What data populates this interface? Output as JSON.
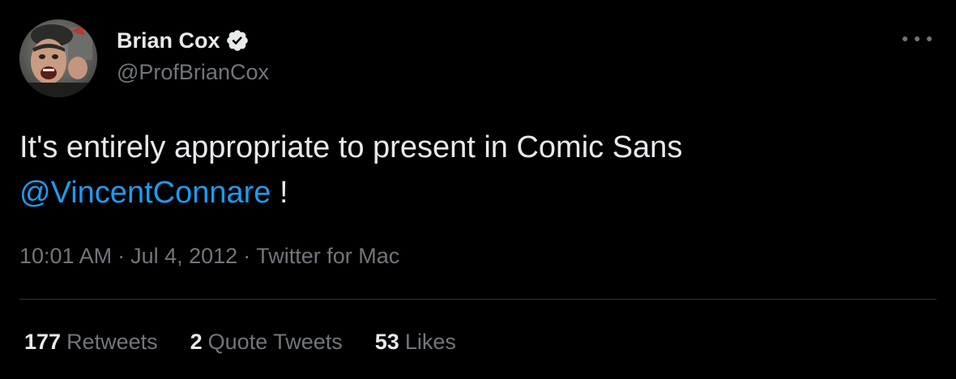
{
  "author": {
    "display_name": "Brian Cox",
    "handle": "@ProfBrianCox",
    "verified_icon": "verified-badge-icon"
  },
  "tweet": {
    "text_main": "It's entirely appropriate to present in Comic Sans",
    "mention": "@VincentConnare",
    "text_tail": " !"
  },
  "meta": {
    "time": "10:01 AM",
    "separator": "·",
    "date": "Jul 4, 2012",
    "source": "Twitter for Mac"
  },
  "stats": {
    "retweets_count": "177",
    "retweets_label": "Retweets",
    "quotes_count": "2",
    "quotes_label": "Quote Tweets",
    "likes_count": "53",
    "likes_label": "Likes"
  },
  "colors": {
    "background": "#000000",
    "primary_text": "#e7e9ea",
    "secondary_text": "#71767b",
    "link": "#1d9bf0",
    "divider": "#2f3336"
  }
}
